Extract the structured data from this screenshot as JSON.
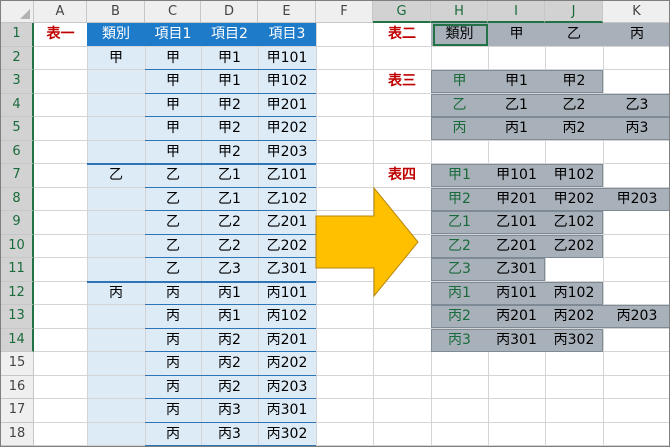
{
  "columns": [
    "A",
    "B",
    "C",
    "D",
    "E",
    "F",
    "G",
    "H",
    "I",
    "J",
    "K"
  ],
  "rows": [
    "1",
    "2",
    "3",
    "4",
    "5",
    "6",
    "7",
    "8",
    "9",
    "10",
    "11",
    "12",
    "13",
    "14",
    "15",
    "16",
    "17",
    "18"
  ],
  "table1": {
    "label": "表一",
    "headers": [
      "類別",
      "項目1",
      "項目2",
      "項目3"
    ],
    "rows": [
      [
        "甲",
        "甲",
        "甲1",
        "甲101"
      ],
      [
        "",
        "甲",
        "甲1",
        "甲102"
      ],
      [
        "",
        "甲",
        "甲2",
        "甲201"
      ],
      [
        "",
        "甲",
        "甲2",
        "甲202"
      ],
      [
        "",
        "甲",
        "甲2",
        "甲203"
      ],
      [
        "乙",
        "乙",
        "乙1",
        "乙101"
      ],
      [
        "",
        "乙",
        "乙1",
        "乙102"
      ],
      [
        "",
        "乙",
        "乙2",
        "乙201"
      ],
      [
        "",
        "乙",
        "乙2",
        "乙202"
      ],
      [
        "",
        "乙",
        "乙3",
        "乙301"
      ],
      [
        "丙",
        "丙",
        "丙1",
        "丙101"
      ],
      [
        "",
        "丙",
        "丙1",
        "丙102"
      ],
      [
        "",
        "丙",
        "丙2",
        "丙201"
      ],
      [
        "",
        "丙",
        "丙2",
        "丙202"
      ],
      [
        "",
        "丙",
        "丙2",
        "丙203"
      ],
      [
        "",
        "丙",
        "丙3",
        "丙301"
      ],
      [
        "",
        "丙",
        "丙3",
        "丙302"
      ]
    ]
  },
  "table2": {
    "label": "表二",
    "cells": [
      "類別",
      "甲",
      "乙",
      "丙"
    ]
  },
  "table3": {
    "label": "表三",
    "rows": [
      [
        "甲",
        "甲1",
        "甲2",
        ""
      ],
      [
        "乙",
        "乙1",
        "乙2",
        "乙3"
      ],
      [
        "丙",
        "丙1",
        "丙2",
        "丙3"
      ]
    ]
  },
  "table4": {
    "label": "表四",
    "rows": [
      [
        "甲1",
        "甲101",
        "甲102",
        ""
      ],
      [
        "甲2",
        "甲201",
        "甲202",
        "甲203"
      ],
      [
        "乙1",
        "乙101",
        "乙102",
        ""
      ],
      [
        "乙2",
        "乙201",
        "乙202",
        ""
      ],
      [
        "乙3",
        "乙301",
        "",
        ""
      ],
      [
        "丙1",
        "丙101",
        "丙102",
        ""
      ],
      [
        "丙2",
        "丙201",
        "丙202",
        "丙203"
      ],
      [
        "丙3",
        "丙301",
        "丙302",
        ""
      ]
    ]
  },
  "colors": {
    "header_blue": "#1e7bc9",
    "light_blue": "#ddebf7",
    "gray": "#a8b0b9",
    "label_red": "#c00000",
    "arrow": "#ffc000",
    "selection_green": "#217346"
  },
  "icons": {
    "arrow": "right-arrow-shape"
  }
}
